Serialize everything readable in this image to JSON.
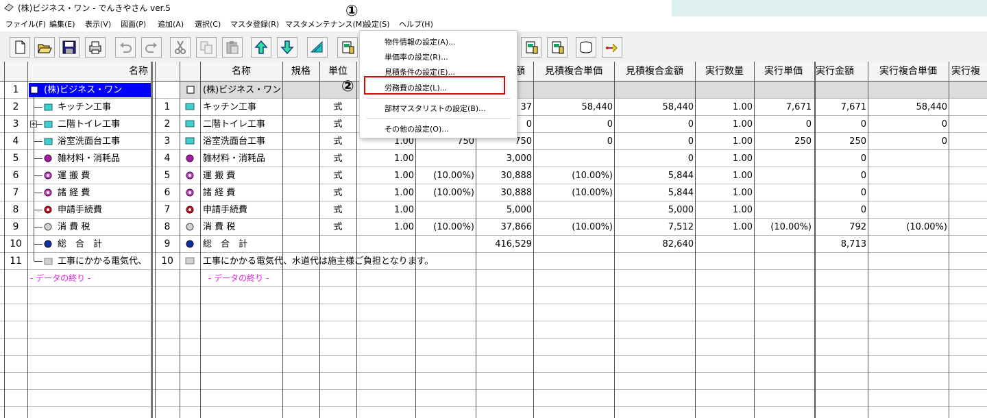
{
  "window": {
    "title": "(株)ビジネス・ワン - でんきやさん ver.5"
  },
  "menu": [
    "ファイル(F)",
    "編集(E)",
    "表示(V)",
    "図面(P)",
    "追加(A)",
    "選択(C)",
    "マスタ登録(R)",
    "マスタメンテナンス(M)",
    "設定(S)",
    "ヘルプ(H)"
  ],
  "toolbar": [
    "new-icon",
    "open-icon",
    "save-icon",
    "print-icon",
    "undo-icon",
    "redo-icon",
    "cut-icon",
    "copy-icon",
    "paste-icon",
    "up-arrow-icon",
    "down-arrow-icon",
    "ruler-icon",
    "calc-icon",
    "calc2-icon",
    "calc3-icon",
    "calc4-icon",
    "database-icon",
    "wrench-icon"
  ],
  "settings_menu": {
    "items": [
      "物件情報の設定(A)...",
      "単価率の設定(R)...",
      "見積条件の設定(E)...",
      "労務費の設定(L)...",
      "部材マスタリストの設定(B)...",
      "その他の設定(O)..."
    ]
  },
  "annotations": {
    "step1": "①",
    "step2": "②"
  },
  "tree": {
    "header": "名称",
    "rows": [
      "(株)ビジネス・ワン",
      "キッチン工事",
      "二階トイレ工事",
      "浴室洗面台工事",
      "雑材料・消耗品",
      "運 搬 費",
      "諸 経 費",
      "申請手続費",
      "消 費 税",
      "総　合　計",
      "工事にかかる電気代、"
    ],
    "row_numbers": [
      "1",
      "2",
      "3",
      "4",
      "5",
      "6",
      "7",
      "8",
      "9",
      "10",
      "11"
    ],
    "end": "- データの終り -"
  },
  "table": {
    "headers": [
      "名称",
      "規格",
      "単位",
      "額",
      "見積複合単価",
      "見積複合金額",
      "実行数量",
      "実行単価",
      "実行金額",
      "実行複合単価",
      "実行複"
    ],
    "total_row": "(株)ビジネス・ワン",
    "rows": [
      {
        "no": "1",
        "name": "キッチン工事",
        "unit": "式",
        "qty": "",
        "price": "",
        "amount": "37",
        "cup": "58,440",
        "camt": "58,440",
        "eqty": "1.00",
        "eprice": "7,671",
        "eamt": "7,671",
        "ecup": "58,440"
      },
      {
        "no": "2",
        "name": "二階トイレ工事",
        "unit": "式",
        "qty": "",
        "price": "",
        "amount": "0",
        "cup": "0",
        "camt": "0",
        "eqty": "1.00",
        "eprice": "0",
        "eamt": "0",
        "ecup": "0"
      },
      {
        "no": "3",
        "name": "浴室洗面台工事",
        "unit": "式",
        "qty": "1.00",
        "price": "750",
        "amount": "750",
        "cup": "0",
        "camt": "0",
        "eqty": "1.00",
        "eprice": "250",
        "eamt": "250",
        "ecup": "0"
      },
      {
        "no": "4",
        "name": "雑材料・消耗品",
        "unit": "式",
        "qty": "1.00",
        "price": "",
        "amount": "3,000",
        "cup": "",
        "camt": "0",
        "eqty": "1.00",
        "eprice": "",
        "eamt": "0",
        "ecup": ""
      },
      {
        "no": "5",
        "name": "運 搬 費",
        "unit": "式",
        "qty": "1.00",
        "price": "(10.00%)",
        "amount": "30,888",
        "cup": "(10.00%)",
        "camt": "5,844",
        "eqty": "1.00",
        "eprice": "",
        "eamt": "0",
        "ecup": ""
      },
      {
        "no": "6",
        "name": "諸 経 費",
        "unit": "式",
        "qty": "1.00",
        "price": "(10.00%)",
        "amount": "30,888",
        "cup": "(10.00%)",
        "camt": "5,844",
        "eqty": "1.00",
        "eprice": "",
        "eamt": "0",
        "ecup": ""
      },
      {
        "no": "7",
        "name": "申請手続費",
        "unit": "式",
        "qty": "1.00",
        "price": "",
        "amount": "5,000",
        "cup": "",
        "camt": "5,000",
        "eqty": "1.00",
        "eprice": "",
        "eamt": "0",
        "ecup": ""
      },
      {
        "no": "8",
        "name": "消 費 税",
        "unit": "式",
        "qty": "1.00",
        "price": "(10.00%)",
        "amount": "37,866",
        "cup": "(10.00%)",
        "camt": "7,512",
        "eqty": "1.00",
        "eprice": "(10.00%)",
        "eamt": "792",
        "ecup": "(10.00%)"
      },
      {
        "no": "9",
        "name": "総　合　計",
        "unit": "",
        "qty": "",
        "price": "",
        "amount": "416,529",
        "cup": "",
        "camt": "82,640",
        "eqty": "",
        "eprice": "",
        "eamt": "8,713",
        "ecup": ""
      },
      {
        "no": "10",
        "name": "工事にかかる電気代、水道代は施主様ご負担となります。",
        "unit": "",
        "qty": "",
        "price": "",
        "amount": "",
        "cup": "",
        "camt": "",
        "eqty": "",
        "eprice": "",
        "eamt": "",
        "ecup": ""
      }
    ],
    "end": "- データの終り -"
  },
  "colors": {
    "selected": "#0000ff",
    "highlight": "#e00000",
    "end_marker": "#e020e0"
  }
}
